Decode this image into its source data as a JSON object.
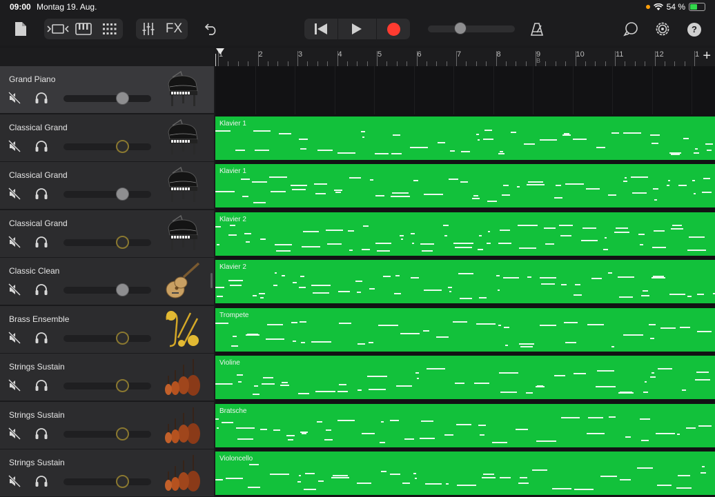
{
  "status": {
    "time": "09:00",
    "date": "Montag 19. Aug.",
    "battery": "54 %",
    "battery_level": 0.54
  },
  "toolbar": {
    "fx_label": "FX",
    "help_label": "?",
    "master_volume": 0.35,
    "icons": [
      "document-icon",
      "tracks-view-icon",
      "keyboard-icon",
      "grid-icon",
      "mixer-icon",
      "undo-icon",
      "go-to-start-icon",
      "play-icon",
      "record-icon",
      "metronome-icon",
      "loop-browser-icon",
      "settings-icon",
      "help-icon"
    ]
  },
  "ruler": {
    "bars": [
      "1",
      "2",
      "3",
      "4",
      "5",
      "6",
      "7",
      "8",
      "9",
      "10",
      "11",
      "12",
      "1"
    ],
    "marker": "B",
    "add_label": "+"
  },
  "colors": {
    "region": "#12c13b",
    "record": "#ff3b30",
    "background": "#1a1a1c"
  },
  "tracks": [
    {
      "name": "Grand Piano",
      "region": "",
      "volume": 0.7,
      "icon": "grand-piano-icon",
      "knob": "grey",
      "selected": true
    },
    {
      "name": "Classical Grand",
      "region": "Klavier 1",
      "volume": 0.7,
      "icon": "grand-piano-icon",
      "knob": "dark",
      "selected": false
    },
    {
      "name": "Classical Grand",
      "region": "Klavier 1",
      "volume": 0.7,
      "icon": "grand-piano-icon",
      "knob": "grey",
      "selected": false
    },
    {
      "name": "Classical Grand",
      "region": "Klavier 2",
      "volume": 0.7,
      "icon": "grand-piano-icon",
      "knob": "dark",
      "selected": false
    },
    {
      "name": "Classic Clean",
      "region": "Klavier 2",
      "volume": 0.7,
      "icon": "guitar-icon",
      "knob": "grey",
      "selected": false
    },
    {
      "name": "Brass Ensemble",
      "region": "Trompete",
      "volume": 0.7,
      "icon": "brass-icon",
      "knob": "dark",
      "selected": false
    },
    {
      "name": "Strings Sustain",
      "region": "Violine",
      "volume": 0.7,
      "icon": "strings-icon",
      "knob": "dark",
      "selected": false
    },
    {
      "name": "Strings Sustain",
      "region": "Bratsche",
      "volume": 0.7,
      "icon": "strings-icon",
      "knob": "dark",
      "selected": false
    },
    {
      "name": "Strings Sustain",
      "region": "Violoncello",
      "volume": 0.7,
      "icon": "strings-icon",
      "knob": "dark",
      "selected": false
    }
  ]
}
